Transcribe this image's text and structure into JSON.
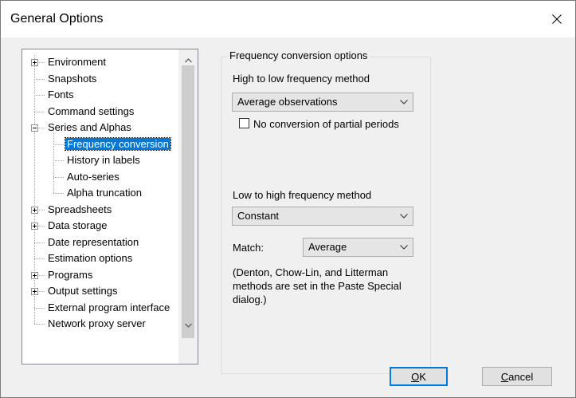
{
  "window": {
    "title": "General Options"
  },
  "tree": {
    "items": [
      {
        "label": "Environment",
        "level": 0,
        "expander": "plus"
      },
      {
        "label": "Snapshots",
        "level": 0
      },
      {
        "label": "Fonts",
        "level": 0
      },
      {
        "label": "Command settings",
        "level": 0
      },
      {
        "label": "Series and Alphas",
        "level": 0,
        "expander": "minus"
      },
      {
        "label": "Frequency conversion",
        "level": 1,
        "selected": true
      },
      {
        "label": "History in labels",
        "level": 1
      },
      {
        "label": "Auto-series",
        "level": 1
      },
      {
        "label": "Alpha truncation",
        "level": 1
      },
      {
        "label": "Spreadsheets",
        "level": 0,
        "expander": "plus"
      },
      {
        "label": "Data storage",
        "level": 0,
        "expander": "plus"
      },
      {
        "label": "Date representation",
        "level": 0
      },
      {
        "label": "Estimation options",
        "level": 0
      },
      {
        "label": "Programs",
        "level": 0,
        "expander": "plus"
      },
      {
        "label": "Output settings",
        "level": 0,
        "expander": "plus"
      },
      {
        "label": "External program interface",
        "level": 0
      },
      {
        "label": "Network proxy server",
        "level": 0
      }
    ]
  },
  "freq": {
    "group_title": "Frequency conversion options",
    "high_to_low_label": "High to low frequency method",
    "high_to_low_value": "Average observations",
    "no_partial_label": "No conversion of partial periods",
    "no_partial_checked": false,
    "low_to_high_label": "Low to high frequency method",
    "low_to_high_value": "Constant",
    "match_label": "Match:",
    "match_value": "Average",
    "note": "(Denton, Chow-Lin, and Litterman methods are set in the Paste Special dialog.)"
  },
  "buttons": {
    "ok_mnemonic": "O",
    "ok_rest": "K",
    "cancel_mnemonic": "C",
    "cancel_rest": "ancel"
  }
}
